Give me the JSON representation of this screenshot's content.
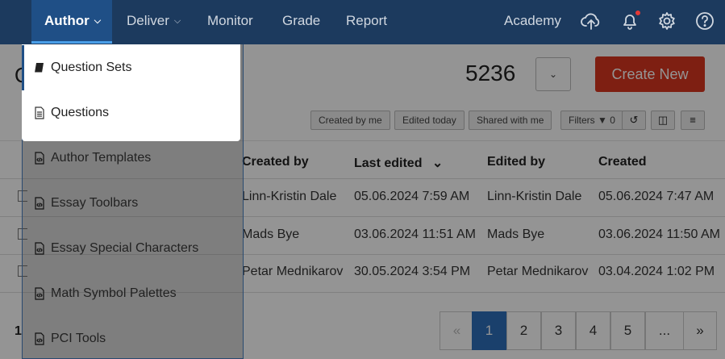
{
  "nav": {
    "items": [
      {
        "label": "Author",
        "active": true,
        "caret": true
      },
      {
        "label": "Deliver",
        "active": false,
        "caret": true
      },
      {
        "label": "Monitor",
        "active": false,
        "caret": false
      },
      {
        "label": "Grade",
        "active": false,
        "caret": false
      },
      {
        "label": "Report",
        "active": false,
        "caret": false
      }
    ],
    "academy_label": "Academy",
    "icons": [
      "upload-cloud-icon",
      "bell-icon",
      "gear-icon",
      "help-icon"
    ]
  },
  "page": {
    "title_initial": "Q",
    "count": "5236",
    "create_label": "Create New"
  },
  "filters": {
    "created_by_me": "Created by me",
    "edited_today": "Edited today",
    "shared_with_me": "Shared with me",
    "filters_label": "Filters",
    "filters_count": "0"
  },
  "table": {
    "headers": {
      "created_by": "Created by",
      "last_edited": "Last edited",
      "edited_by": "Edited by",
      "created": "Created"
    },
    "rows": [
      {
        "created_by": "Linn-Kristin Dale",
        "last_edited": "05.06.2024 7:59 AM",
        "edited_by": "Linn-Kristin Dale",
        "created": "05.06.2024 7:47 AM"
      },
      {
        "created_by": "Mads Bye",
        "last_edited": "03.06.2024 11:51 AM",
        "edited_by": "Mads Bye",
        "created": "03.06.2024 11:50 AM"
      },
      {
        "created_by": "Petar Mednikarov",
        "last_edited": "30.05.2024 3:54 PM",
        "edited_by": "Petar Mednikarov",
        "created": "03.04.2024 1:02 PM"
      }
    ]
  },
  "footer": {
    "count_prefix": "1"
  },
  "pagination": {
    "prev": "«",
    "pages": [
      "1",
      "2",
      "3",
      "4",
      "5"
    ],
    "ellipsis": "...",
    "next": "»",
    "current": "1"
  },
  "menu": {
    "items": [
      {
        "label": "Question Sets",
        "icon": "book-icon"
      },
      {
        "label": "Questions",
        "icon": "document-icon"
      },
      {
        "label": "Author Templates",
        "icon": "code-file-icon"
      },
      {
        "label": "Essay Toolbars",
        "icon": "code-file-icon"
      },
      {
        "label": "Essay Special Characters",
        "icon": "code-file-icon"
      },
      {
        "label": "Math Symbol Palettes",
        "icon": "code-file-icon"
      },
      {
        "label": "PCI Tools",
        "icon": "code-file-icon"
      }
    ]
  }
}
